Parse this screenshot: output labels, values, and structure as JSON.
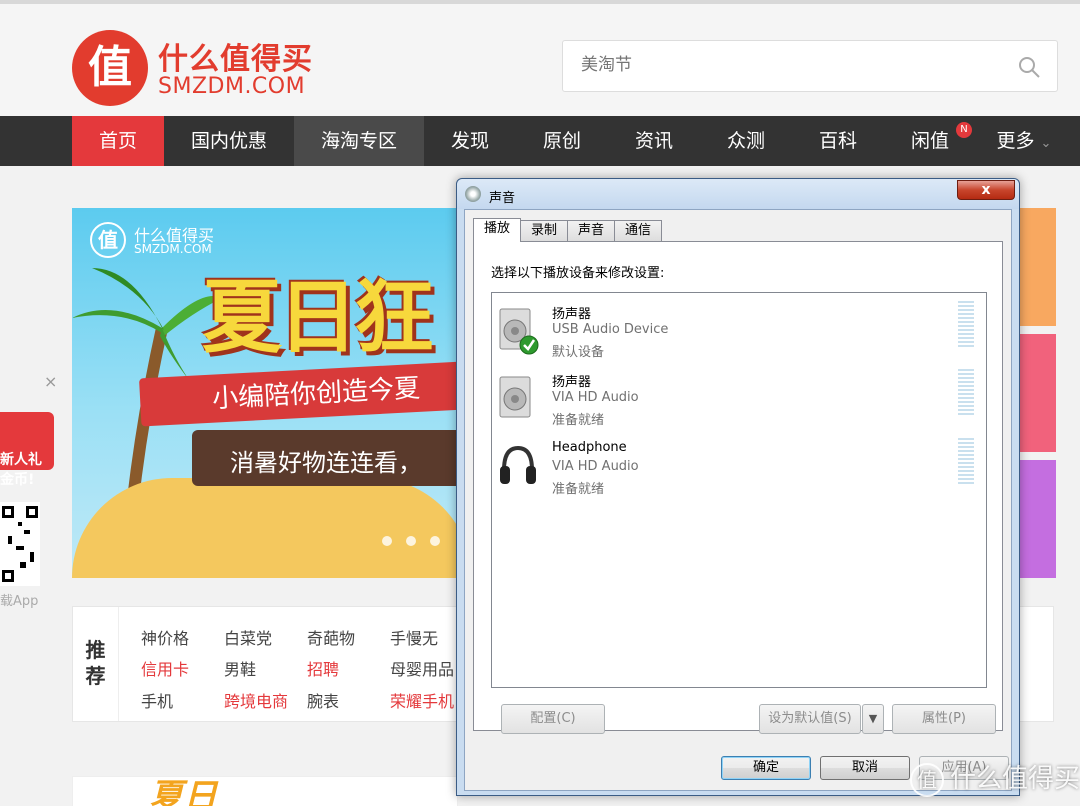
{
  "site": {
    "logo_char": "值",
    "logo_cn": "什么值得买",
    "logo_en": "SMZDM.COM",
    "search_placeholder": "美淘节"
  },
  "nav": {
    "items": [
      "首页",
      "国内优惠",
      "海淘专区",
      "发现",
      "原创",
      "资讯",
      "众测",
      "百科",
      "闲值",
      "更多"
    ],
    "badge": "N",
    "more_chevron": "chevron-down-icon"
  },
  "banner": {
    "logo_char": "值",
    "logo_cn": "什么值得买",
    "logo_en": "SMZDM.COM",
    "headline": "夏日狂",
    "ribbon": "小编陪你创造今夏",
    "band": "消暑好物连连看，"
  },
  "float_ad": {
    "close": "×",
    "line1": "新人礼",
    "line2": "金币!",
    "app": "载App"
  },
  "recommend": {
    "title_top": "推",
    "title_bottom": "荐",
    "rows": [
      [
        "神价格",
        "白菜党",
        "奇葩物",
        "手慢无"
      ],
      [
        "信用卡",
        "男鞋",
        "招聘",
        "母婴用品"
      ],
      [
        "手机",
        "跨境电商",
        "腕表",
        "荣耀手机"
      ]
    ]
  },
  "summer_box": {
    "text": "夏日"
  },
  "dialog": {
    "title": "声音",
    "close": "x",
    "tabs": [
      "播放",
      "录制",
      "声音",
      "通信"
    ],
    "prompt": "选择以下播放设备来修改设置:",
    "devices": [
      {
        "name": "扬声器",
        "driver": "USB Audio Device",
        "status": "默认设备",
        "icon": "speaker-icon",
        "is_default": true
      },
      {
        "name": "扬声器",
        "driver": "VIA HD Audio",
        "status": "准备就绪",
        "icon": "speaker-icon",
        "is_default": false
      },
      {
        "name": "Headphone",
        "driver": "VIA HD Audio",
        "status": "准备就绪",
        "icon": "headphone-icon",
        "is_default": false
      }
    ],
    "buttons": {
      "configure": "配置(C)",
      "set_default": "设为默认值(S)",
      "properties": "属性(P)",
      "ok": "确定",
      "cancel": "取消",
      "apply": "应用(A)"
    }
  },
  "watermark": {
    "badge": "值",
    "text": "什么值得买"
  }
}
